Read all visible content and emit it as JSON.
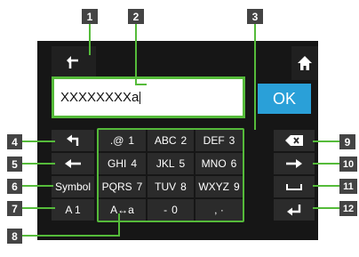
{
  "input": {
    "value": "XXXXXXXXa"
  },
  "ok_label": "OK",
  "left_keys": {
    "symbol": "Symbol",
    "a1": "A 1"
  },
  "grid_keys": [
    {
      "chars": ".@",
      "digit": "1"
    },
    {
      "chars": "ABC",
      "digit": "2"
    },
    {
      "chars": "DEF",
      "digit": "3"
    },
    {
      "chars": "GHI",
      "digit": "4"
    },
    {
      "chars": "JKL",
      "digit": "5"
    },
    {
      "chars": "MNO",
      "digit": "6"
    },
    {
      "chars": "PQRS",
      "digit": "7"
    },
    {
      "chars": "TUV",
      "digit": "8"
    },
    {
      "chars": "WXYZ",
      "digit": "9"
    },
    {
      "chars": "A↔a",
      "digit": ""
    },
    {
      "chars": "-",
      "digit": "0"
    },
    {
      "chars": ", ·",
      "digit": ""
    }
  ],
  "callouts": [
    "1",
    "2",
    "3",
    "4",
    "5",
    "6",
    "7",
    "8",
    "9",
    "10",
    "11",
    "12"
  ],
  "colors": {
    "highlight": "#55bb3a",
    "ok": "#2aa0d8",
    "screen": "#161616",
    "key": "#2b2b2b",
    "callout": "#444444"
  },
  "icons": {
    "back_top": "return-arrow-icon",
    "home": "home-icon",
    "back_key": "return-arrow-icon",
    "left": "left-arrow-icon",
    "delete": "backspace-icon",
    "right": "right-arrow-icon",
    "space": "space-icon",
    "enter": "enter-icon"
  }
}
